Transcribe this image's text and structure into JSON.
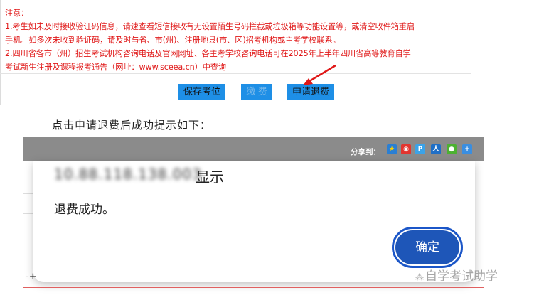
{
  "notice": {
    "heading": "注意：",
    "line1": "1.考生如未及时接收验证码信息，请速查看短信接收有无设置陌生号码拦截或垃圾箱等功能设置等，或清空收件箱重启",
    "line2": "手机。如多次未收到验证码，请及时与省、市(州)、注册地县(市、区)招考机构或主考学校联系。",
    "line3": "2.四川省各市（州）招生考试机构咨询电话及官网网址、各主考学校咨询电话可在2025年上半年四川省高等教育自学",
    "line4": "考试新生注册及课程报考通告（网址：www.sceea.cn）中查询"
  },
  "buttons": {
    "save": "保存考位",
    "pay": "缴 费",
    "refund": "申请退费"
  },
  "caption": "点击申请退费后成功提示如下：",
  "share": {
    "label": "分享到：",
    "icons": [
      "qzone-icon",
      "weibo-icon",
      "pengyou-icon",
      "renren-icon",
      "wechat-icon",
      "more-icon"
    ]
  },
  "dialog": {
    "host": "10.88.118.138.003",
    "show_label": "显示",
    "message": "退费成功。",
    "ok_label": "确定"
  },
  "fragment": "-+",
  "watermark": "自学考试助学",
  "colors": {
    "notice_red": "#e01818",
    "button_blue": "#1e8fe6",
    "ok_blue": "#1e56b8",
    "share_bar": "#8b8b8b"
  }
}
